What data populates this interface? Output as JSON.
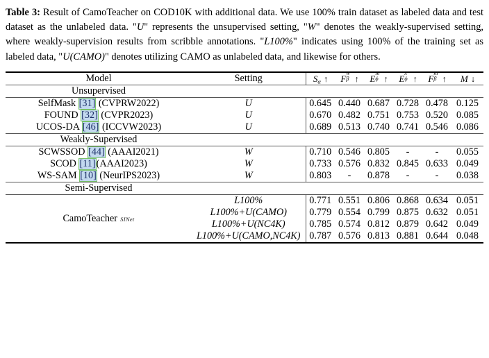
{
  "caption": {
    "label": "Table 3:",
    "parts": [
      {
        "t": "Result of CamoTeacher on COD10K with additional data. We use 100% train dataset as labeled data and test dataset as the unlabeled data. \"",
        "style": "normal"
      },
      {
        "t": "U",
        "style": "italic"
      },
      {
        "t": "\" represents the unsupervised setting, \"",
        "style": "normal"
      },
      {
        "t": "W",
        "style": "italic"
      },
      {
        "t": "\" denotes the weakly-supervised setting, where weakly-supervision results from scribble annotations. \"",
        "style": "normal"
      },
      {
        "t": "L100%",
        "style": "italic"
      },
      {
        "t": "\" indicates using 100% of the training set as labeled data, \"",
        "style": "normal"
      },
      {
        "t": "U(CAMO)",
        "style": "italic"
      },
      {
        "t": "\" denotes utilizing CAMO as unlabeled data, and likewise for others.",
        "style": "normal"
      }
    ],
    "full_text": "Table 3: Result of CamoTeacher on COD10K with additional data. We use 100% train dataset as labeled data and test dataset as the unlabeled data. \"U\" represents the unsupervised setting, \"W\" denotes the weakly-supervised setting, where weakly-supervision results from scribble annotations. \"L100%\" indicates using 100% of the training set as labeled data, \"U(CAMO)\" denotes utilizing CAMO as unlabeled data, and likewise for others."
  },
  "table": {
    "headers": {
      "model": "Model",
      "setting": "Setting",
      "metrics": [
        {
          "base": "S",
          "sub": "α",
          "sup": "",
          "arrow": "↑"
        },
        {
          "base": "F",
          "sub": "β",
          "sup": "w",
          "arrow": "↑"
        },
        {
          "base": "E",
          "sub": "ϕ",
          "sup": "m",
          "arrow": "↑"
        },
        {
          "base": "E",
          "sub": "ϕ",
          "sup": "x",
          "arrow": "↑"
        },
        {
          "base": "F",
          "sub": "β",
          "sup": "m",
          "arrow": "↑"
        },
        {
          "base": "M",
          "sub": "",
          "sup": "",
          "arrow": "↓"
        }
      ]
    },
    "sections": [
      {
        "label": "Unsupervised",
        "rows": [
          {
            "name": "SelfMask",
            "cite": "31",
            "venue": "(CVPRW2022)",
            "space_before_venue": true,
            "setting": "U",
            "values": [
              "0.645",
              "0.440",
              "0.687",
              "0.728",
              "0.478",
              "0.125"
            ]
          },
          {
            "name": "FOUND",
            "cite": "32",
            "venue": "(CVPR2023)",
            "space_before_venue": true,
            "setting": "U",
            "values": [
              "0.670",
              "0.482",
              "0.751",
              "0.753",
              "0.520",
              "0.085"
            ]
          },
          {
            "name": "UCOS-DA",
            "cite": "46",
            "venue": "(ICCVW2023)",
            "space_before_venue": true,
            "setting": "U",
            "values": [
              "0.689",
              "0.513",
              "0.740",
              "0.741",
              "0.546",
              "0.086"
            ]
          }
        ]
      },
      {
        "label": "Weakly-Supervised",
        "rows": [
          {
            "name": "SCWSSOD",
            "cite": "44",
            "venue": "(AAAI2021)",
            "space_before_venue": true,
            "setting": "W",
            "values": [
              "0.710",
              "0.546",
              "0.805",
              "-",
              "-",
              "0.055"
            ]
          },
          {
            "name": "SCOD",
            "cite": "11",
            "venue": "(AAAI2023)",
            "space_before_venue": false,
            "setting": "W",
            "values": [
              "0.733",
              "0.576",
              "0.832",
              "0.845",
              "0.633",
              "0.049"
            ]
          },
          {
            "name": "WS-SAM",
            "cite": "10",
            "venue": "(NeurIPS2023)",
            "space_before_venue": true,
            "setting": "W",
            "values": [
              "0.803",
              "-",
              "0.878",
              "-",
              "-",
              "0.038"
            ]
          }
        ]
      },
      {
        "label": "Semi-Supervised",
        "rows": [
          {
            "name": "CamoTeacher",
            "name_sub": "SINet",
            "cite": "",
            "venue": "",
            "setting": "L100%",
            "values": [
              "0.771",
              "0.551",
              "0.806",
              "0.868",
              "0.634",
              "0.051"
            ]
          },
          {
            "name": "",
            "cite": "",
            "venue": "",
            "setting": "L100%+U(CAMO)",
            "values": [
              "0.779",
              "0.554",
              "0.799",
              "0.875",
              "0.632",
              "0.051"
            ]
          },
          {
            "name": "",
            "cite": "",
            "venue": "",
            "setting": "L100%+U(NC4K)",
            "values": [
              "0.785",
              "0.574",
              "0.812",
              "0.879",
              "0.642",
              "0.049"
            ]
          },
          {
            "name": "",
            "cite": "",
            "venue": "",
            "setting": "L100%+U(CAMO,NC4K)",
            "values": [
              "0.787",
              "0.576",
              "0.813",
              "0.881",
              "0.644",
              "0.048"
            ]
          }
        ]
      }
    ]
  },
  "colors": {
    "cite_border": "#79c26a",
    "cite_fill": "#c3d9ef",
    "rule": "#000000",
    "text": "#000000"
  }
}
